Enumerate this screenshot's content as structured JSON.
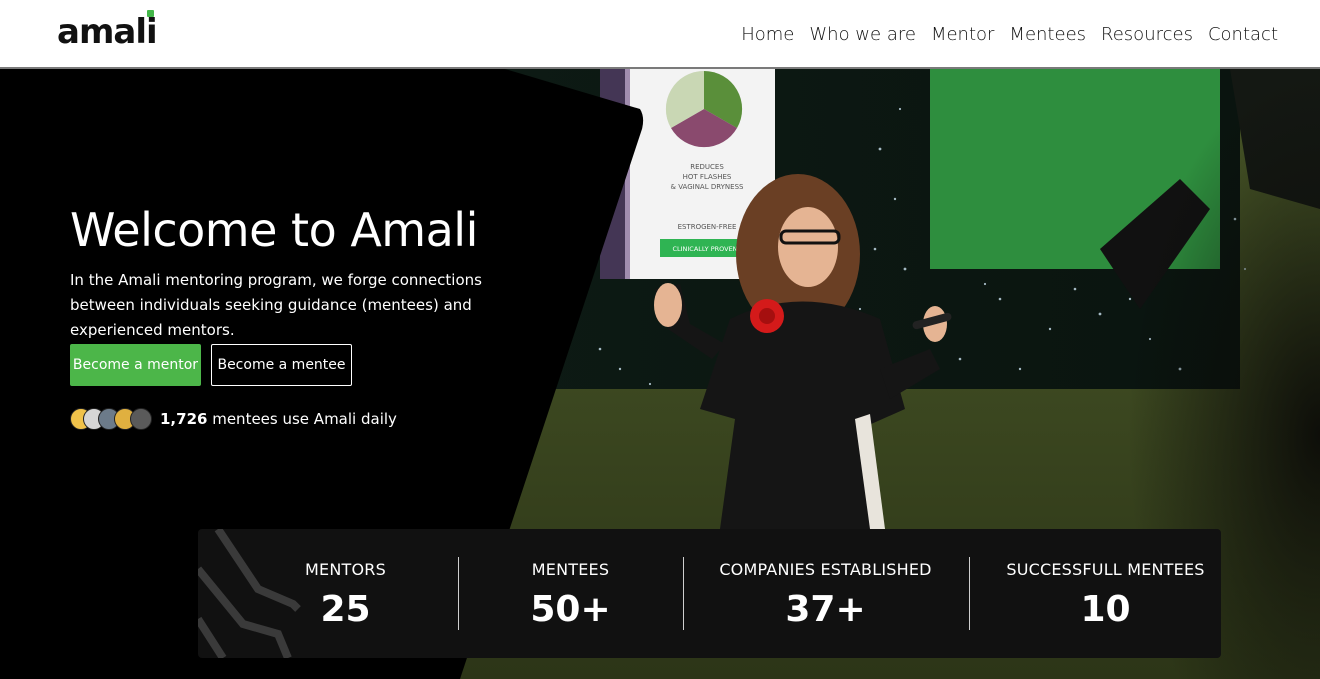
{
  "brand": {
    "logo_text": "amali",
    "accent_color": "#4cb649"
  },
  "nav": {
    "items": [
      {
        "label": "Home"
      },
      {
        "label": "Who we are"
      },
      {
        "label": "Mentor"
      },
      {
        "label": "Mentees"
      },
      {
        "label": "Resources"
      },
      {
        "label": "Contact"
      }
    ]
  },
  "hero": {
    "title": "Welcome to Amali",
    "description": "In the Amali mentoring program, we forge connections between individuals seeking guidance (mentees) and experienced mentors.",
    "primary_button": "Become a mentor",
    "secondary_button": "Become a mentee",
    "social_count": "1,726",
    "social_text": " mentees use Amali daily"
  },
  "stats": [
    {
      "label": "MENTORS",
      "value": "25"
    },
    {
      "label": "MENTEES",
      "value": "50+"
    },
    {
      "label": "COMPANIES ESTABLISHED",
      "value": "37+"
    },
    {
      "label": "SUCCESSFULL MENTEES",
      "value": "10"
    }
  ],
  "backdrop_screen": {
    "line1": "REDUCES",
    "line2": "HOT FLASHES",
    "line3": "& VAGINAL DRYNESS",
    "line4": "ESTROGEN-FREE",
    "badge": "CLINICALLY PROVEN"
  }
}
